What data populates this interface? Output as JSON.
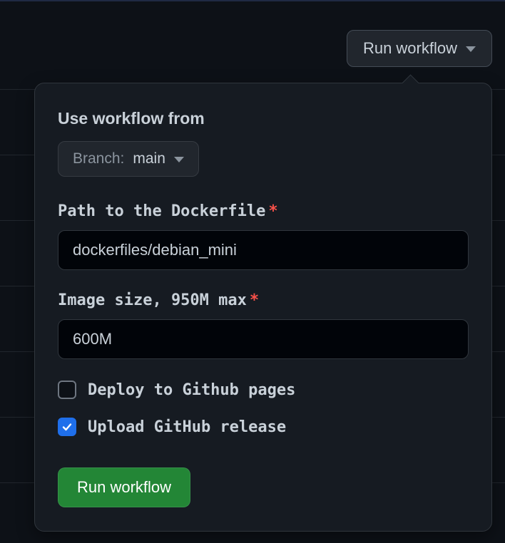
{
  "trigger": {
    "label": "Run workflow"
  },
  "popover": {
    "use_from_label": "Use workflow from",
    "branch": {
      "prefix": "Branch:",
      "name": "main"
    },
    "fields": {
      "dockerfile": {
        "label": "Path to the Dockerfile",
        "required": true,
        "value": "dockerfiles/debian_mini"
      },
      "image_size": {
        "label": "Image size, 950M max",
        "required": true,
        "value": "600M"
      }
    },
    "checkboxes": {
      "deploy_pages": {
        "label": "Deploy to Github pages",
        "checked": false
      },
      "upload_release": {
        "label": "Upload GitHub release",
        "checked": true
      }
    },
    "submit_label": "Run workflow"
  }
}
